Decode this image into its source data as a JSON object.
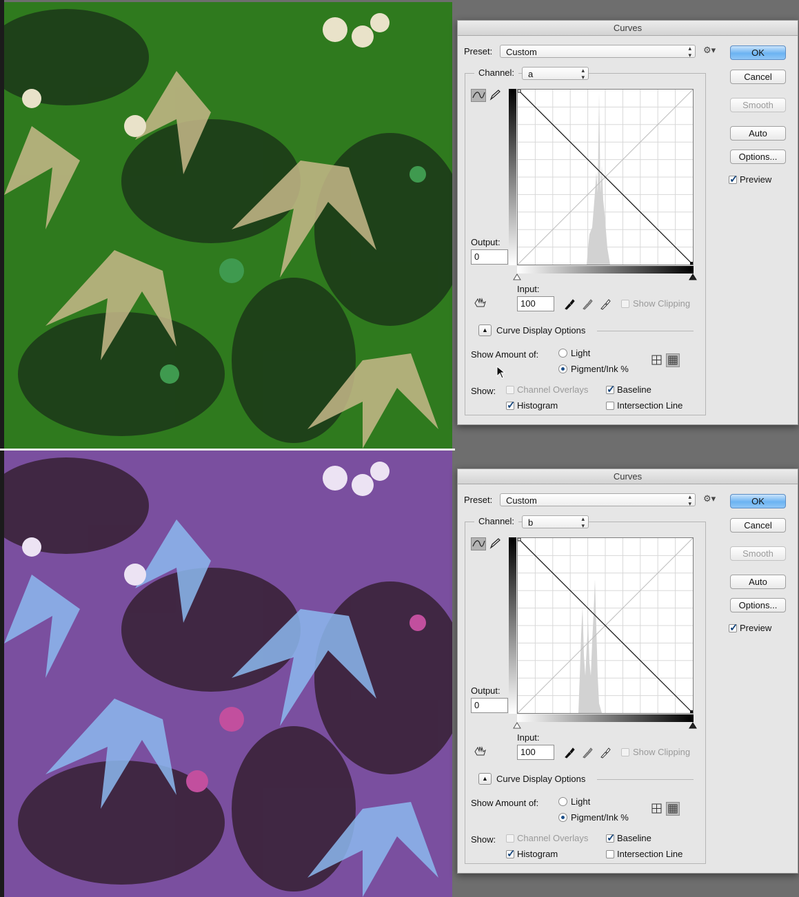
{
  "dialog_title": "Curves",
  "dialogs": [
    {
      "preset_label": "Preset:",
      "preset_value": "Custom",
      "channel_label": "Channel:",
      "channel_value": "a",
      "buttons": {
        "ok": "OK",
        "cancel": "Cancel",
        "smooth": "Smooth",
        "auto": "Auto",
        "options": "Options..."
      },
      "preview_label": "Preview",
      "preview_checked": true,
      "output_label": "Output:",
      "output_value": "0",
      "input_label": "Input:",
      "input_value": "100",
      "show_clipping_label": "Show Clipping",
      "curve_display_options_label": "Curve Display Options",
      "show_amount_label": "Show Amount of:",
      "light_label": "Light",
      "pigment_label": "Pigment/Ink %",
      "show_amount_selected": "Pigment/Ink %",
      "show_label": "Show:",
      "channel_overlays_label": "Channel Overlays",
      "baseline_label": "Baseline",
      "histogram_label": "Histogram",
      "intersection_label": "Intersection Line",
      "baseline_checked": true,
      "histogram_checked": true,
      "intersection_checked": false
    },
    {
      "preset_label": "Preset:",
      "preset_value": "Custom",
      "channel_label": "Channel:",
      "channel_value": "b",
      "buttons": {
        "ok": "OK",
        "cancel": "Cancel",
        "smooth": "Smooth",
        "auto": "Auto",
        "options": "Options..."
      },
      "preview_label": "Preview",
      "preview_checked": true,
      "output_label": "Output:",
      "output_value": "0",
      "input_label": "Input:",
      "input_value": "100",
      "show_clipping_label": "Show Clipping",
      "curve_display_options_label": "Curve Display Options",
      "show_amount_label": "Show Amount of:",
      "light_label": "Light",
      "pigment_label": "Pigment/Ink %",
      "show_amount_selected": "Pigment/Ink %",
      "show_label": "Show:",
      "channel_overlays_label": "Channel Overlays",
      "baseline_label": "Baseline",
      "histogram_label": "Histogram",
      "intersection_label": "Intersection Line",
      "baseline_checked": true,
      "histogram_checked": true,
      "intersection_checked": false
    }
  ],
  "colors": {
    "top_image_background": "#2f7a1e",
    "bottom_image_background": "#7a4f9f",
    "accent_button": "#6cb3f2"
  },
  "icons": [
    "gear-icon",
    "curve-tool-icon",
    "pencil-icon",
    "hand-target-icon",
    "black-eyedropper-icon",
    "gray-eyedropper-icon",
    "white-eyedropper-icon",
    "simple-grid-icon",
    "detailed-grid-icon",
    "disclosure-triangle-icon",
    "mouse-cursor-icon"
  ]
}
